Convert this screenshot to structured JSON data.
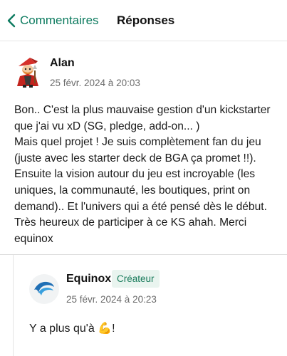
{
  "header": {
    "back_label": "Commentaires",
    "title": "Réponses"
  },
  "comment": {
    "author": "Alan",
    "timestamp": "25 févr. 2024 à 20:03",
    "lines": [
      "Bon.. C'est la plus mauvaise gestion d'un kickstarter",
      "que j'ai vu xD (SG, pledge, add-on... )",
      "Mais quel projet ! Je suis complètement fan du jeu",
      "(juste avec les starter deck de BGA ça promet !!).",
      "Ensuite la vision autour du jeu est incroyable (les",
      "uniques, la communauté, les boutiques, print on",
      "demand).. Et l'univers qui a été pensé dès le début.",
      "Très heureux de participer à ce KS ahah. Merci",
      "equinox"
    ]
  },
  "reply": {
    "author": "Equinox",
    "badge": "Créateur",
    "timestamp": "25 févr. 2024 à 20:23",
    "text": "Y a plus qu'à 💪!"
  },
  "colors": {
    "accent": "#0b7a5e",
    "badge_bg": "#e9f4ef",
    "muted_text": "#6b6b6b"
  },
  "icons": {
    "back": "chevron-left-icon",
    "equinox_logo": "wave-logo-icon"
  }
}
